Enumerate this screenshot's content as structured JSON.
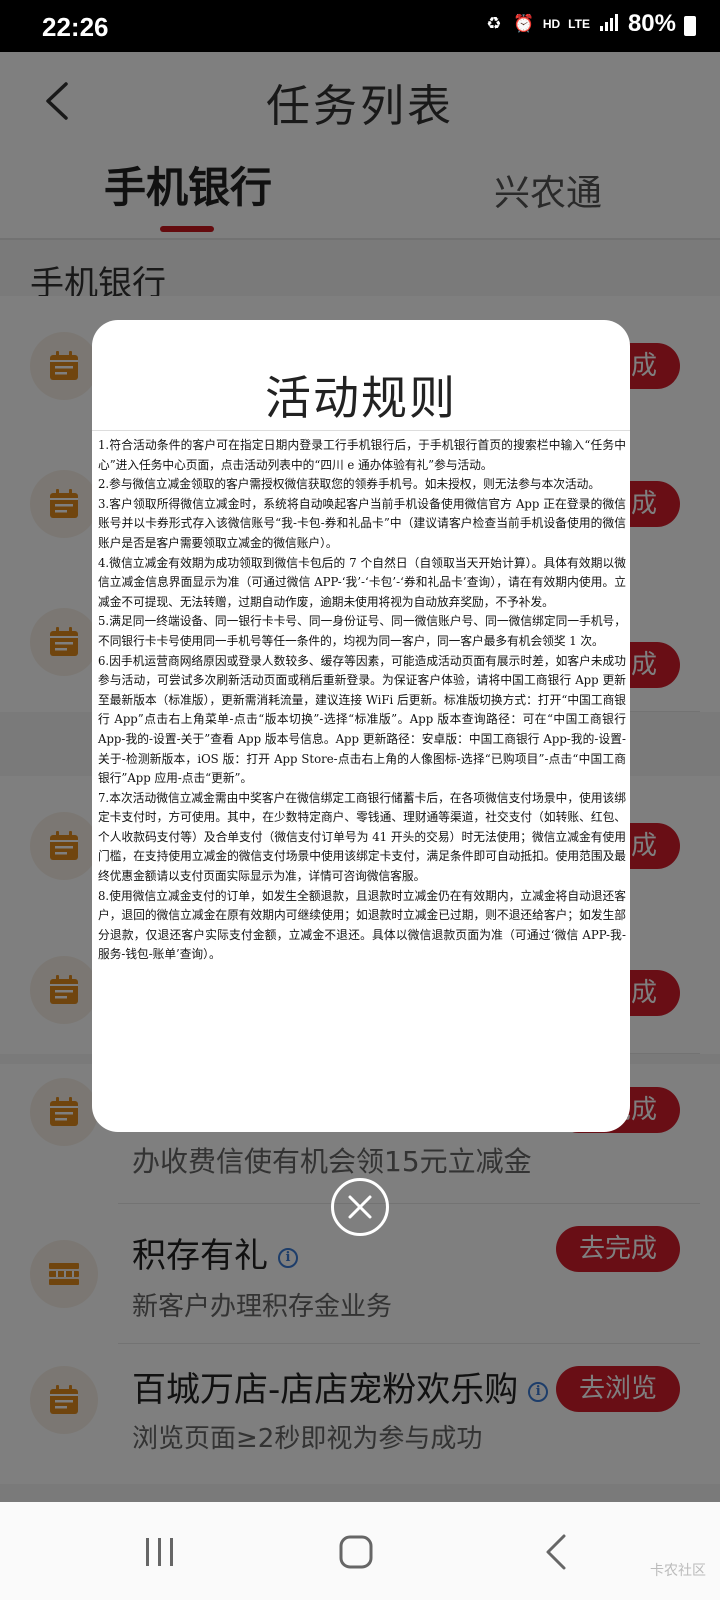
{
  "status_bar": {
    "time": "22:26",
    "network": "HD",
    "lte": "LTE",
    "battery": "80%"
  },
  "header": {
    "title": "任务列表",
    "tabs": [
      {
        "label": "手机银行",
        "active": true
      },
      {
        "label": "兴农通",
        "active": false
      }
    ]
  },
  "section_title": "手机银行",
  "tasks": [
    {
      "title": "",
      "subtitle": "",
      "button": "去完成",
      "icon": "calendar-icon"
    },
    {
      "title": "",
      "subtitle": "",
      "button": "去完成",
      "icon": "calendar-icon"
    },
    {
      "title": "",
      "subtitle": "",
      "button": "去完成",
      "icon": "calendar-icon"
    },
    {
      "title": "",
      "subtitle": "",
      "button": "去完成",
      "icon": "calendar-icon"
    },
    {
      "title": "",
      "subtitle": "",
      "button": "去完成",
      "icon": "calendar-icon"
    },
    {
      "title": "",
      "subtitle": "办收费信使有机会领15元立减金",
      "button": "去完成",
      "icon": "calendar-icon"
    },
    {
      "title": "积存有礼",
      "subtitle": "新客户办理积存金业务",
      "button": "去完成",
      "icon": "gold-bar-icon"
    },
    {
      "title": "百城万店-店店宠粉欢乐购",
      "subtitle": "浏览页面≥2秒即视为参与成功",
      "button": "去浏览",
      "icon": "calendar-icon"
    }
  ],
  "modal": {
    "title": "活动规则",
    "rules": [
      "1.符合活动条件的客户可在指定日期内登录工行手机银行后，于手机银行首页的搜索栏中输入“任务中心”进入任务中心页面，点击活动列表中的“四川 e 通办体验有礼”参与活动。",
      "2.参与微信立减金领取的客户需授权微信获取您的领券手机号。如未授权，则无法参与本次活动。",
      "3.客户领取所得微信立减金时，系统将自动唤起客户当前手机设备使用微信官方 App 正在登录的微信账号并以卡券形式存入该微信账号“我-卡包-券和礼品卡”中（建议请客户检查当前手机设备使用的微信账户是否是客户需要领取立减金的微信账户）。",
      "4.微信立减金有效期为成功领取到微信卡包后的 7 个自然日（自领取当天开始计算）。具体有效期以微信立减金信息界面显示为准（可通过微信 APP-‘我’-‘卡包’-‘券和礼品卡’查询），请在有效期内使用。立减金不可提现、无法转赠，过期自动作废，逾期未使用将视为自动放弃奖励，不予补发。",
      "5.满足同一终端设备、同一银行卡卡号、同一身份证号、同一微信账户号、同一微信绑定同一手机号，不同银行卡卡号使用同一手机号等任一条件的，均视为同一客户，同一客户最多有机会领奖 1 次。",
      "6.因手机运营商网络原因或登录人数较多、缓存等因素，可能造成活动页面有展示时差，如客户未成功参与活动，可尝试多次刷新活动页面或稍后重新登录。为保证客户体验，请将中国工商银行 App 更新至最新版本（标准版），更新需消耗流量，建议连接 WiFi 后更新。标准版切换方式：打开“中国工商银行 App”点击右上角菜单-点击“版本切换”-选择“标准版”。App 版本查询路径：可在“中国工商银行 App-我的-设置-关于”查看 App 版本号信息。App 更新路径：安卓版：中国工商银行 App-我的-设置-关于-检测新版本，iOS 版：打开 App Store-点击右上角的人像图标-选择“已购项目”-点击“中国工商银行”App 应用-点击“更新”。",
      "7.本次活动微信立减金需由中奖客户在微信绑定工商银行储蓄卡后，在各项微信支付场景中，使用该绑定卡支付时，方可使用。其中，在少数特定商户、零钱通、理财通等渠道，社交支付（如转账、红包、个人收款码支付等）及合单支付（微信支付订单号为 41 开头的交易）时无法使用；微信立减金有使用门槛，在支持使用立减金的微信支付场景中使用该绑定卡支付，满足条件即可自动抵扣。使用范围及最终优惠金额请以支付页面实际显示为准，详情可咨询微信客服。",
      "8.使用微信立减金支付的订单，如发生全额退款，且退款时立减金仍在有效期内，立减金将自动退还客户，退回的微信立减金在原有效期内可继续使用；如退款时立减金已过期，则不退还给客户；如发生部分退款，仅退还客户实际支付金额，立减金不退还。具体以微信退款页面为准（可通过‘微信 APP-我-服务-钱包-账单’查询）。"
    ]
  },
  "watermark": "卡农社区",
  "colors": {
    "accent_red": "#d21d2b",
    "tab_underline": "#c8161d",
    "icon_orange": "#e08a1c",
    "info_blue": "#3a7bd5"
  }
}
